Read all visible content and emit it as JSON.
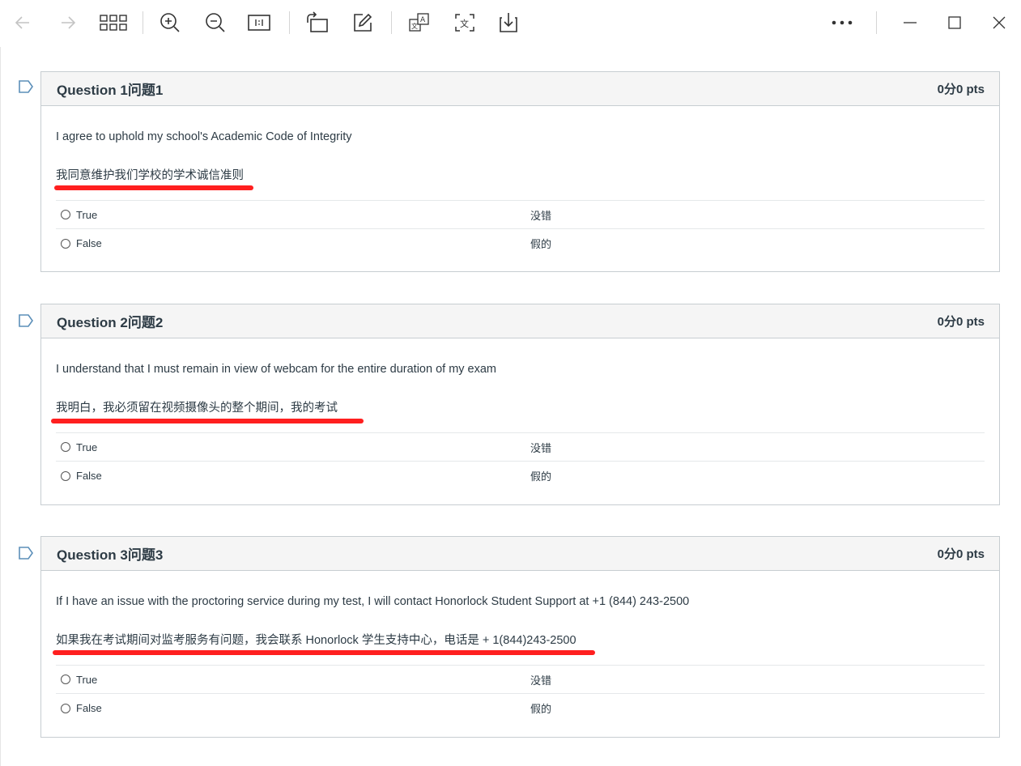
{
  "toolbar": {
    "icons": [
      "back-icon",
      "forward-icon",
      "grid-view-icon",
      "zoom-in-icon",
      "zoom-out-icon",
      "actual-size-icon",
      "rotate-icon",
      "edit-icon",
      "translate-document-icon",
      "translate-selection-icon",
      "download-icon",
      "more-icon",
      "minimize-icon",
      "maximize-icon",
      "close-icon"
    ]
  },
  "questions": [
    {
      "title": "Question 1问题1",
      "points": "0分0 pts",
      "text_en": "I agree to uphold my school's Academic Code of Integrity",
      "text_zh": "我同意维护我们学校的学术诚信准则",
      "answers": [
        {
          "label": "True",
          "translation": "没错"
        },
        {
          "label": "False",
          "translation": "假的"
        }
      ]
    },
    {
      "title": "Question 2问题2",
      "points": "0分0 pts",
      "text_en": "I understand that I must remain in view of webcam for the entire duration of my exam",
      "text_zh": "我明白，我必须留在视频摄像头的整个期间，我的考试",
      "answers": [
        {
          "label": "True",
          "translation": "没错"
        },
        {
          "label": "False",
          "translation": "假的"
        }
      ]
    },
    {
      "title": "Question 3问题3",
      "points": "0分0 pts",
      "text_en": "If I have an issue with the proctoring service during my test, I will contact Honorlock Student Support at +1 (844) 243-2500",
      "text_zh": "如果我在考试期间对监考服务有问题，我会联系 Honorlock 学生支持中心，电话是 + 1(844)243-2500",
      "answers": [
        {
          "label": "True",
          "translation": "没错"
        },
        {
          "label": "False",
          "translation": "假的"
        }
      ]
    }
  ],
  "colors": {
    "annotation_underline": "#ff1f1f",
    "header_bg": "#f5f5f5",
    "border": "#c7cdd1",
    "flag": "#5b8fb9"
  }
}
